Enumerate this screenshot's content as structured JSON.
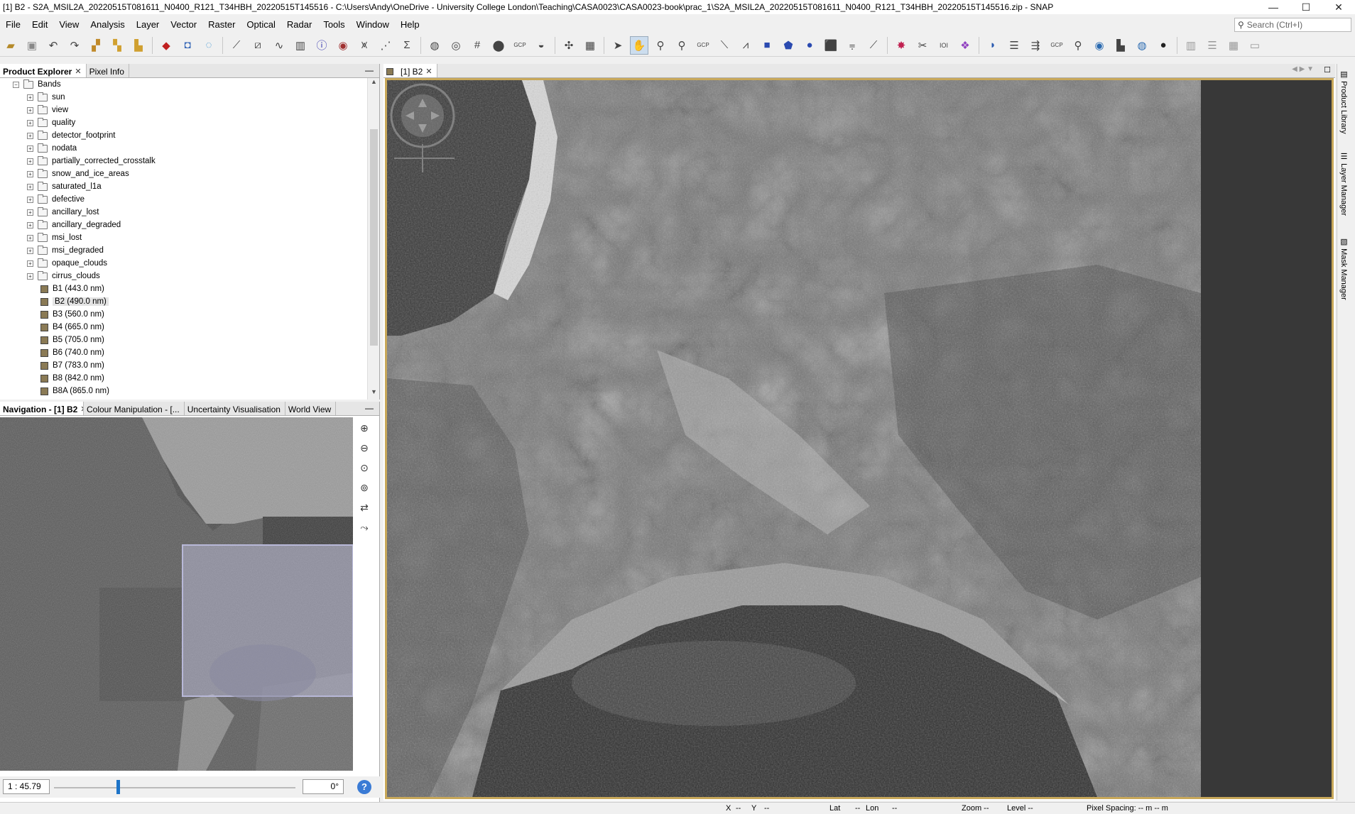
{
  "window": {
    "title": "[1] B2 - S2A_MSIL2A_20220515T081611_N0400_R121_T34HBH_20220515T145516 - C:\\Users\\Andy\\OneDrive - University College London\\Teaching\\CASA0023\\CASA0023-book\\prac_1\\S2A_MSIL2A_20220515T081611_N0400_R121_T34HBH_20220515T145516.zip - SNAP",
    "minimize": "—",
    "maximize": "☐",
    "close": "✕"
  },
  "menu": [
    "File",
    "Edit",
    "View",
    "Analysis",
    "Layer",
    "Vector",
    "Raster",
    "Optical",
    "Radar",
    "Tools",
    "Window",
    "Help"
  ],
  "search": {
    "placeholder": "Search (Ctrl+I)"
  },
  "product_explorer": {
    "tabs": [
      {
        "label": "Product Explorer",
        "close": "✕"
      },
      {
        "label": "Pixel Info"
      }
    ],
    "minimize": "—",
    "root": "Bands",
    "folders": [
      "sun",
      "view",
      "quality",
      "detector_footprint",
      "nodata",
      "partially_corrected_crosstalk",
      "snow_and_ice_areas",
      "saturated_l1a",
      "defective",
      "ancillary_lost",
      "ancillary_degraded",
      "msi_lost",
      "msi_degraded",
      "opaque_clouds",
      "cirrus_clouds"
    ],
    "bands": [
      "B1 (443.0 nm)",
      "B2 (490.0 nm)",
      "B3 (560.0 nm)",
      "B4 (665.0 nm)",
      "B5 (705.0 nm)",
      "B6 (740.0 nm)",
      "B7 (783.0 nm)",
      "B8 (842.0 nm)",
      "B8A (865.0 nm)"
    ],
    "selected_band": "B2 (490.0 nm)",
    "expander_plus": "+",
    "expander_minus": "−"
  },
  "navigation": {
    "tabs": [
      {
        "label": "Navigation - [1] B2",
        "close": "✕"
      },
      {
        "label": "Colour Manipulation - [..."
      },
      {
        "label": "Uncertainty Visualisation"
      },
      {
        "label": "World View"
      }
    ],
    "minimize": "—",
    "scale": "1 : 45.79",
    "rotation": "0°",
    "zoom_level": 0.26,
    "help": "?"
  },
  "viewer": {
    "tab": "[1] B2",
    "close": "✕"
  },
  "right_sidebar": [
    "Product Library",
    "Layer Manager",
    "Mask Manager"
  ],
  "status": {
    "x": "X",
    "x_val": "--",
    "y": "Y",
    "y_val": "--",
    "lat": "Lat",
    "lat_val": "--",
    "lon": "Lon",
    "lon_val": "--",
    "zoom": "Zoom --",
    "level": "Level --",
    "pixel_spacing": "Pixel Spacing: -- m -- m"
  },
  "icons": {
    "toolbar": [
      "open-product-icon",
      "save-product-icon",
      "undo-icon",
      "redo-icon",
      "band-maths-icon",
      "rgb-image-icon",
      "histogram-icon",
      "spectrum-icon",
      "scatter-icon",
      "profile-plot-icon",
      "statistics-icon",
      "information-icon",
      "geocoding-icon",
      "time-series-icon",
      "density-plot-icon",
      "sigma-icon",
      "world-map-icon",
      "graticule-icon",
      "gcp-manager-icon",
      "pin-manager-icon",
      "select-tool-icon",
      "pan-tool-icon",
      "zoom-tool-icon",
      "range-finder-icon",
      "magic-wand-icon"
    ],
    "gcp_label": "GCP",
    "ioi_label": "IOI"
  }
}
